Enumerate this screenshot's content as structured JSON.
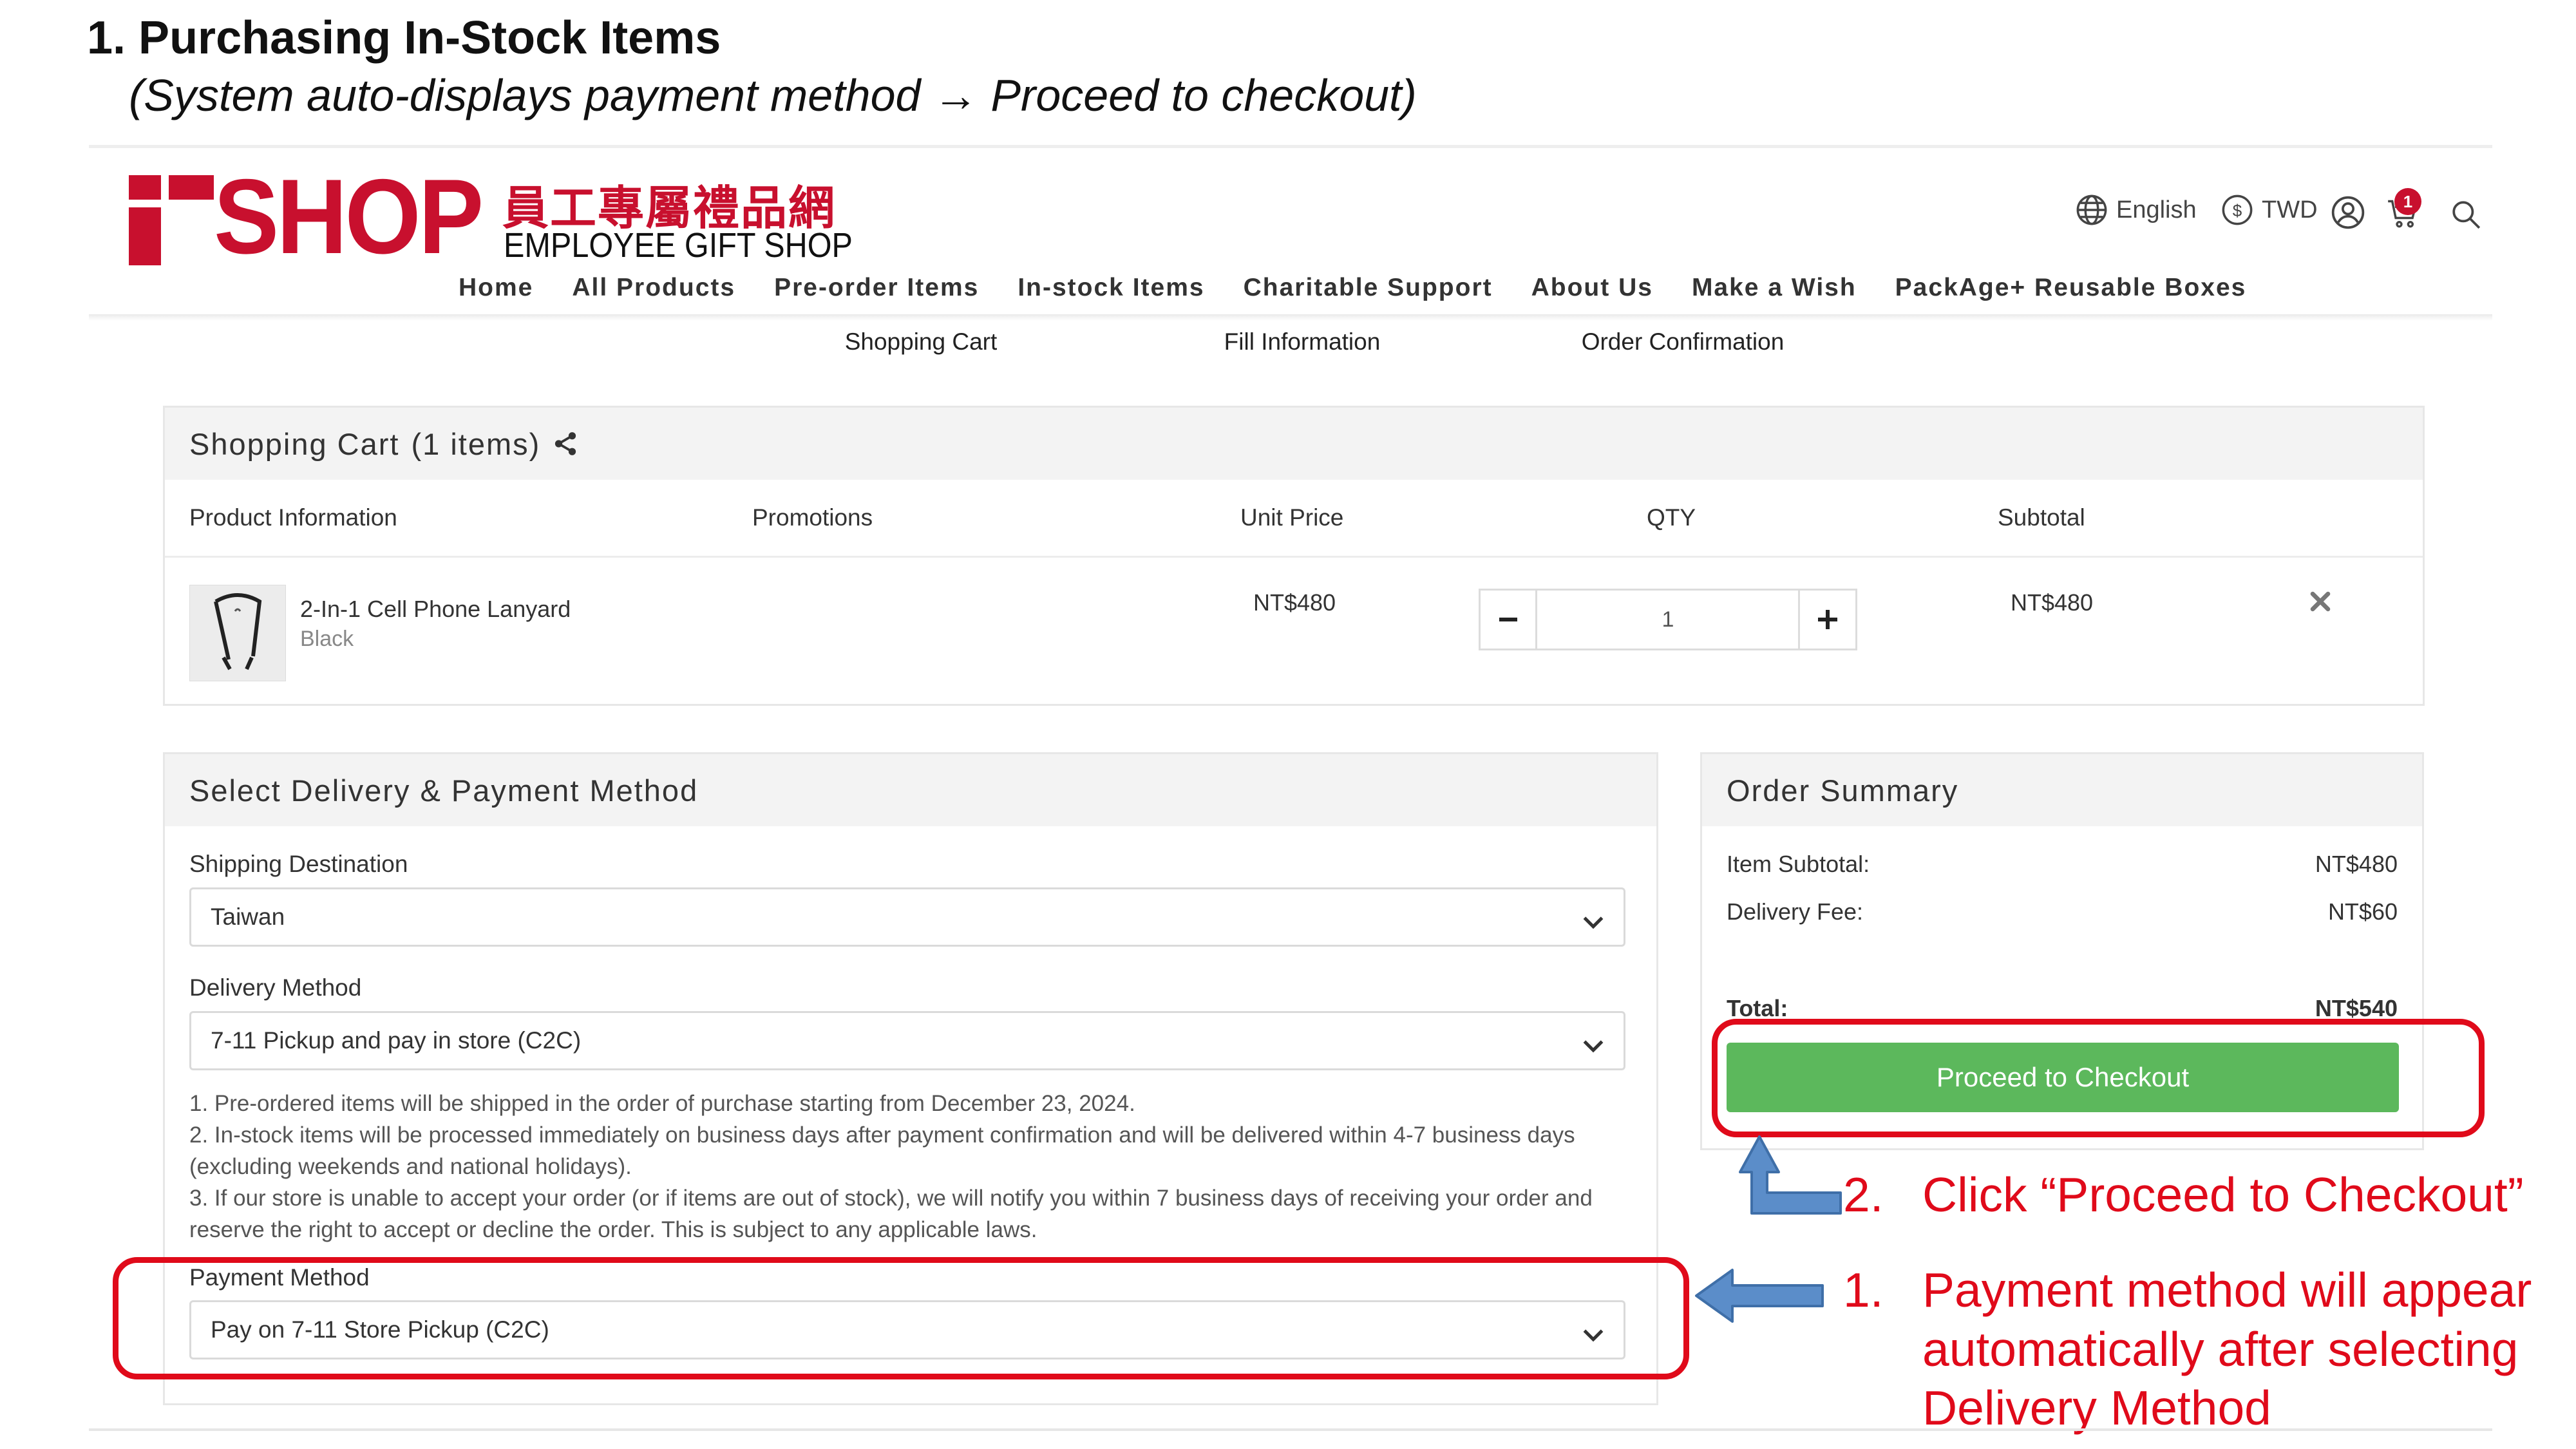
{
  "slide": {
    "title": "1. Purchasing In-Stock Items",
    "subtitle": "(System auto-displays payment method → Proceed to checkout)"
  },
  "logo": {
    "word": "SHOP",
    "chinese": "員工專屬禮品網",
    "english": "EMPLOYEE GIFT SHOP"
  },
  "header": {
    "language": "English",
    "currency": "TWD",
    "cart_count": "1"
  },
  "nav": {
    "items": [
      {
        "label": "Home"
      },
      {
        "label": "All Products"
      },
      {
        "label": "Pre-order Items"
      },
      {
        "label": "In-stock Items"
      },
      {
        "label": "Charitable Support"
      },
      {
        "label": "About Us"
      },
      {
        "label": "Make a Wish"
      },
      {
        "label": "PackAge+ Reusable Boxes"
      }
    ]
  },
  "steps": {
    "items": [
      {
        "label": "Shopping Cart"
      },
      {
        "label": "Fill Information"
      },
      {
        "label": "Order Confirmation"
      }
    ]
  },
  "cart": {
    "title": "Shopping Cart",
    "count_label": "(1 items)",
    "columns": {
      "product": "Product Information",
      "promotions": "Promotions",
      "unit_price": "Unit Price",
      "qty": "QTY",
      "subtotal": "Subtotal"
    },
    "item": {
      "name": "2-In-1 Cell Phone Lanyard",
      "variant": "Black",
      "unit_price": "NT$480",
      "qty": "1",
      "subtotal": "NT$480"
    }
  },
  "delivery": {
    "title": "Select Delivery & Payment Method",
    "shipping_label": "Shipping Destination",
    "shipping_value": "Taiwan",
    "method_label": "Delivery Method",
    "method_value": "7-11 Pickup and pay in store (C2C)",
    "notes": [
      "1. Pre-ordered items will be shipped in the order of purchase starting from December 23, 2024.",
      "2. In-stock items will be processed immediately on business days after payment confirmation and will be delivered within 4-7 business days (excluding weekends and national holidays).",
      "3. If our store is unable to accept your order (or if items are out of stock), we will notify you within 7 business days of receiving your order and reserve the right to accept or decline the order. This is subject to any applicable laws."
    ],
    "payment_label": "Payment Method",
    "payment_value": "Pay on 7-11 Store Pickup (C2C)"
  },
  "summary": {
    "title": "Order Summary",
    "item_subtotal_label": "Item Subtotal:",
    "item_subtotal_value": "NT$480",
    "delivery_fee_label": "Delivery Fee:",
    "delivery_fee_value": "NT$60",
    "total_label": "Total:",
    "total_value": "NT$540",
    "checkout_label": "Proceed to Checkout"
  },
  "annotations": {
    "step2_num": "2.",
    "step2_text": "Click “Proceed to Checkout”",
    "step1_num": "1.",
    "step1_line1": "Payment method will appear",
    "step1_line2": "automatically after selecting",
    "step1_line3": "Delivery Method"
  },
  "colors": {
    "brand_red": "#c8102e",
    "annotation_red": "#e00a1a",
    "checkout_green": "#5cb85c",
    "arrow_blue": "#5b8dc9"
  }
}
